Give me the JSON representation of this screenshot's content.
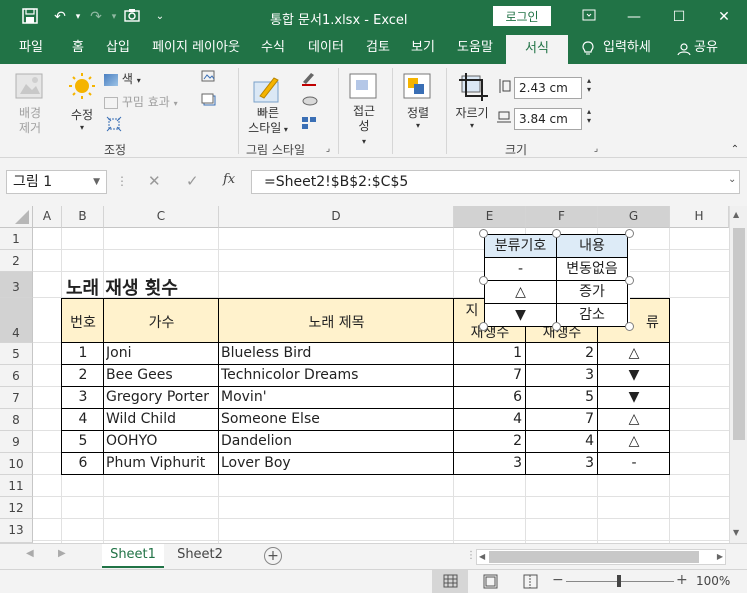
{
  "titlebar": {
    "title": "통합 문서1.xlsx  -  Excel",
    "login": "로그인",
    "save_icon": "save-icon",
    "undo_icon": "undo-icon",
    "redo_icon": "redo-icon",
    "camera_icon": "camera-icon"
  },
  "tabs": [
    "파일",
    "홈",
    "삽입",
    "페이지 레이아웃",
    "수식",
    "데이터",
    "검토",
    "보기",
    "도움말",
    "서식"
  ],
  "active_tab": "서식",
  "tell_me": "입력하세",
  "share": "공유",
  "ribbon": {
    "remove_bg": [
      "배경",
      "제거"
    ],
    "corrections": "수정",
    "color": "색",
    "artistic": "꾸밈 효과",
    "adjust_group": "조정",
    "quick_styles": [
      "빠른",
      "스타일"
    ],
    "picture_styles_group": "그림 스타일",
    "alt_text": [
      "접근",
      "성"
    ],
    "arrange": "정렬",
    "crop": "자르기",
    "height": "2.43 cm",
    "width": "3.84 cm",
    "size_group": "크기"
  },
  "formula_bar": {
    "name_box": "그림 1",
    "formula": "=Sheet2!$B$2:$C$5",
    "fx": "fx"
  },
  "columns": [
    "A",
    "B",
    "C",
    "D",
    "E",
    "F",
    "G",
    "H"
  ],
  "rows": [
    "1",
    "2",
    "3",
    "4",
    "5",
    "6",
    "7",
    "8",
    "9",
    "10",
    "11",
    "12",
    "13"
  ],
  "sheet": {
    "title": "노래 재생 횟수",
    "headers": {
      "no": "번호",
      "singer": "가수",
      "song": "노래 제목",
      "prev_play_top": "지",
      "prev_play_bottom": "재생수",
      "cur_play": "재생수",
      "category": "류"
    },
    "data": [
      {
        "no": "1",
        "singer": "Joni",
        "song": "Blueless Bird",
        "e": "1",
        "f": "2",
        "g": "△"
      },
      {
        "no": "2",
        "singer": "Bee Gees",
        "song": "Technicolor Dreams",
        "e": "7",
        "f": "3",
        "g": "▼"
      },
      {
        "no": "3",
        "singer": "Gregory Porter",
        "song": "Movin'",
        "e": "6",
        "f": "5",
        "g": "▼"
      },
      {
        "no": "4",
        "singer": "Wild Child",
        "song": "Someone Else",
        "e": "4",
        "f": "7",
        "g": "△"
      },
      {
        "no": "5",
        "singer": "OOHYO",
        "song": "Dandelion",
        "e": "2",
        "f": "4",
        "g": "△"
      },
      {
        "no": "6",
        "singer": "Phum Viphurit",
        "song": "Lover Boy",
        "e": "3",
        "f": "3",
        "g": "-"
      }
    ]
  },
  "picture": {
    "header": [
      "분류기호",
      "내용"
    ],
    "rows": [
      [
        "-",
        "변동없음"
      ],
      [
        "△",
        "증가"
      ],
      [
        "▼",
        "감소"
      ]
    ]
  },
  "sheet_tabs": [
    "Sheet1",
    "Sheet2"
  ],
  "active_sheet": "Sheet1",
  "zoom": "100%",
  "colors": {
    "excel_green": "#217346",
    "header_fill": "#fff2cc",
    "picture_header_fill": "#ddebf7"
  }
}
